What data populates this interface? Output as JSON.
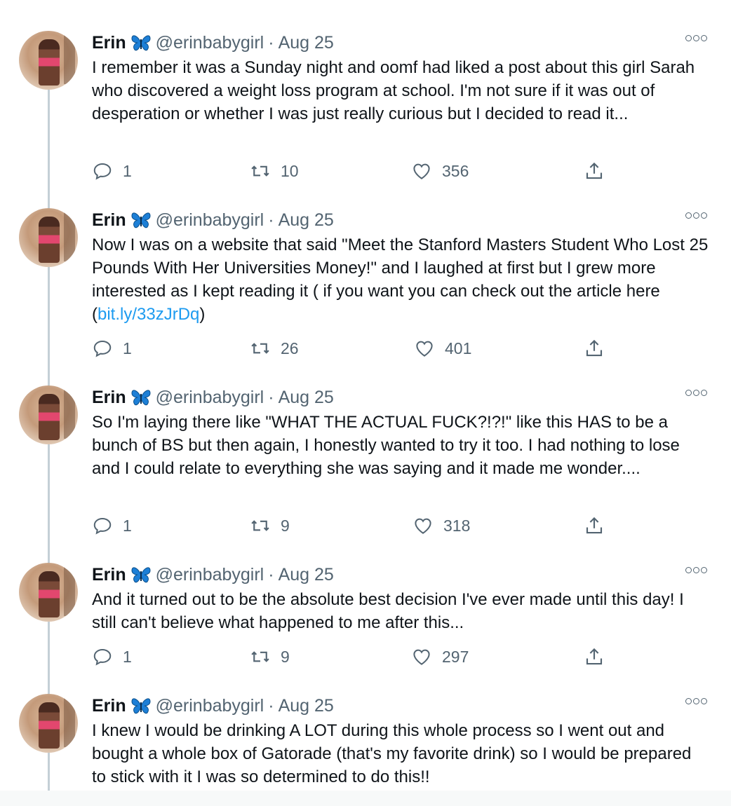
{
  "author": {
    "name": "Erin",
    "handle": "@erinbabygirl",
    "separator": "·"
  },
  "tweets": [
    {
      "date": "Aug 25",
      "text": "I remember it was a Sunday night and oomf had liked a post about this girl Sarah who discovered a weight loss program at school. I'm not sure if it was out of desperation or whether I was just really curious but I decided to read it...",
      "replies": "1",
      "retweets": "10",
      "likes": "356"
    },
    {
      "date": "Aug 25",
      "text": "Now I was on a website that said \"Meet the Stanford Masters Student Who Lost 25 Pounds With Her Universities Money!\" and I laughed at first but I grew more interested as I kept reading it ( if you want you can check out the article here (",
      "link": "bit.ly/33zJrDq",
      "text_after": ")",
      "replies": "1",
      "retweets": "26",
      "likes": "401"
    },
    {
      "date": "Aug 25",
      "text": "So I'm laying there like \"WHAT THE ACTUAL FUCK?!?!\" like this HAS to be a bunch of BS but then again, I honestly wanted to try it too. I had nothing to lose and I could relate to everything she was saying and it made me wonder....",
      "replies": "1",
      "retweets": "9",
      "likes": "318"
    },
    {
      "date": "Aug 25",
      "text": "And it turned out to be the absolute best decision I've ever made until this day! I still can't believe what happened to me after this...",
      "replies": "1",
      "retweets": "9",
      "likes": "297"
    },
    {
      "date": "Aug 25",
      "text": "I knew I would be drinking A LOT during this whole process so I went out and bought a whole box of Gatorade (that's my favorite drink) so I would be prepared to stick with it I was so determined to do this!!"
    }
  ],
  "colors": {
    "link": "#1d9bf0",
    "secondary": "#536471",
    "thread_line": "#c4cfd6",
    "butterfly": "#1d7fd6"
  },
  "icons": [
    "butterfly-emoji-icon",
    "more-icon",
    "reply-icon",
    "retweet-icon",
    "like-icon",
    "share-icon"
  ]
}
